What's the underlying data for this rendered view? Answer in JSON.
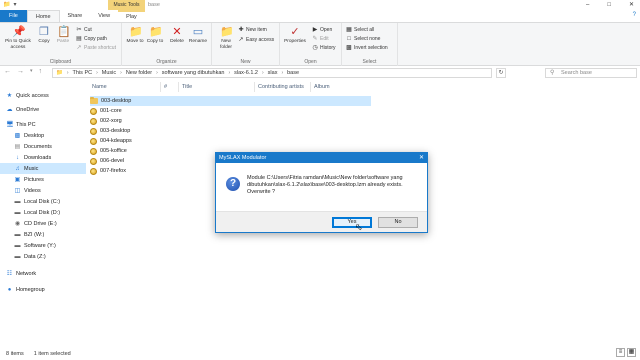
{
  "window": {
    "title": "base",
    "context_tab_title": "Music Tools",
    "controls": [
      "–",
      "□",
      "✕"
    ]
  },
  "ribbon_tabs": [
    {
      "label": "File"
    },
    {
      "label": "Home"
    },
    {
      "label": "Share"
    },
    {
      "label": "View"
    },
    {
      "label": "Play"
    }
  ],
  "ribbon": {
    "clipboard": {
      "label": "Clipboard",
      "pin": "Pin to Quick access",
      "copy": "Copy",
      "paste": "Paste",
      "cut": "Cut",
      "copy_path": "Copy path",
      "paste_shortcut": "Paste shortcut"
    },
    "organize": {
      "label": "Organize",
      "move_to": "Move to",
      "copy_to": "Copy to",
      "delete": "Delete",
      "rename": "Rename"
    },
    "new": {
      "label": "New",
      "new_folder": "New folder",
      "new_item": "New item",
      "easy_access": "Easy access"
    },
    "open": {
      "label": "Open",
      "properties": "Properties",
      "open": "Open",
      "edit": "Edit",
      "history": "History"
    },
    "select": {
      "label": "Select",
      "select_all": "Select all",
      "select_none": "Select none",
      "invert": "Invert selection"
    }
  },
  "address": {
    "crumbs": [
      "This PC",
      "Music",
      "New folder",
      "software yang dibutuhkan",
      "slax-6.1.2",
      "slax",
      "base"
    ],
    "search_placeholder": "Search base"
  },
  "nav_pane": [
    {
      "label": "Quick access",
      "icon": "star-icon"
    },
    {
      "label": "OneDrive",
      "icon": "cloud-icon"
    },
    {
      "label": "This PC",
      "icon": "computer-icon"
    },
    {
      "label": "Desktop",
      "icon": "desktop-icon"
    },
    {
      "label": "Documents",
      "icon": "documents-icon"
    },
    {
      "label": "Downloads",
      "icon": "download-icon"
    },
    {
      "label": "Music",
      "icon": "music-icon"
    },
    {
      "label": "Pictures",
      "icon": "pictures-icon"
    },
    {
      "label": "Videos",
      "icon": "videos-icon"
    },
    {
      "label": "Local Disk (C:)",
      "icon": "disk-icon"
    },
    {
      "label": "Local Disk (D:)",
      "icon": "disk-icon"
    },
    {
      "label": "CD Drive (E:)",
      "icon": "cd-icon"
    },
    {
      "label": "BZI (W:)",
      "icon": "drive-icon"
    },
    {
      "label": "Software (Y:)",
      "icon": "drive-icon"
    },
    {
      "label": "Data (Z:)",
      "icon": "drive-icon"
    },
    {
      "label": "Network",
      "icon": "network-icon"
    },
    {
      "label": "Homegroup",
      "icon": "homegroup-icon"
    }
  ],
  "columns": [
    "Name",
    "#",
    "Title",
    "Contributing artists",
    "Album"
  ],
  "files": [
    {
      "name": "003-desktop",
      "kind": "folder"
    },
    {
      "name": "001-core",
      "kind": "lzm"
    },
    {
      "name": "002-xorg",
      "kind": "lzm"
    },
    {
      "name": "003-desktop",
      "kind": "lzm"
    },
    {
      "name": "004-kdeapps",
      "kind": "lzm"
    },
    {
      "name": "005-koffice",
      "kind": "lzm"
    },
    {
      "name": "006-devel",
      "kind": "lzm"
    },
    {
      "name": "007-firefox",
      "kind": "lzm"
    }
  ],
  "status": {
    "items": "8 items",
    "selected": "1 item selected"
  },
  "dialog": {
    "title": "MySLAX Modulator",
    "message": "Module C:\\Users\\Fitria ramdani\\Music\\New folder\\software yang dibutuhkan\\slax-6.1.2\\slax\\base\\003-desktop.lzm already exists. Overwrite ?",
    "yes": "Yes",
    "no": "No"
  }
}
